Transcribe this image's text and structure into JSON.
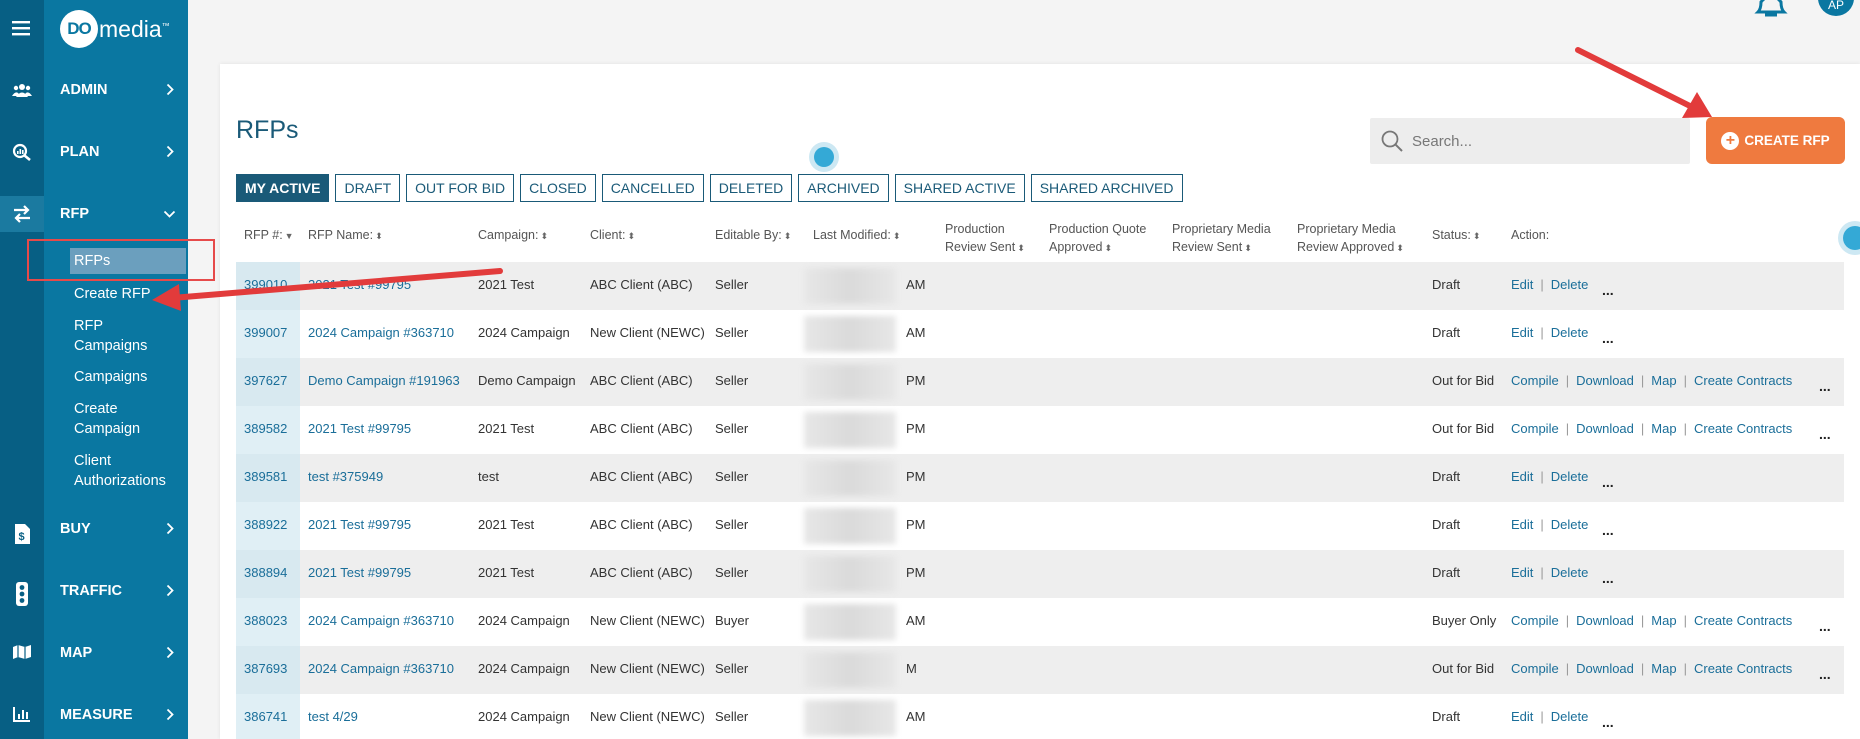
{
  "brand": {
    "logo_do": "DO",
    "logo_media": "media",
    "logo_tm": "™"
  },
  "icons": [
    "hamburger-icon",
    "users-icon",
    "plan-search-icon",
    "rfp-exchange-icon",
    "buy-dollar-icon",
    "traffic-light-icon",
    "map-icon",
    "measure-chart-icon",
    "bell-icon",
    "search-icon",
    "plus-circle-icon",
    "chevron-right-icon",
    "chevron-down-icon",
    "sort-icon"
  ],
  "colors": {
    "sidebar": "#0a77a1",
    "rail": "#075f84",
    "accent": "#ef7a3f",
    "primary": "#1a5a78",
    "highlight_red": "#e64a4a"
  },
  "user": {
    "initials": "AP"
  },
  "sidebar": {
    "admin": "ADMIN",
    "plan": "PLAN",
    "rfp": "RFP",
    "rfp_sub": {
      "rfps": "RFPs",
      "create_rfp": "Create RFP",
      "rfp_campaigns_1": "RFP",
      "rfp_campaigns_2": "Campaigns",
      "campaigns": "Campaigns",
      "create_campaign_1": "Create",
      "create_campaign_2": "Campaign",
      "client_auth_1": "Client",
      "client_auth_2": "Authorizations"
    },
    "buy": "BUY",
    "traffic": "TRAFFIC",
    "map": "MAP",
    "measure": "MEASURE"
  },
  "page": {
    "title": "RFPs",
    "search_placeholder": "Search...",
    "create_button": "CREATE RFP"
  },
  "tabs": [
    "MY ACTIVE",
    "DRAFT",
    "OUT FOR BID",
    "CLOSED",
    "CANCELLED",
    "DELETED",
    "ARCHIVED",
    "SHARED ACTIVE",
    "SHARED ARCHIVED"
  ],
  "columns": {
    "rfp_num": "RFP #:",
    "rfp_name": "RFP Name:",
    "campaign": "Campaign:",
    "client": "Client:",
    "editable_by": "Editable By:",
    "last_modified": "Last Modified:",
    "prod_review_1": "Production",
    "prod_review_2": "Review Sent",
    "prod_quote_1": "Production Quote",
    "prod_quote_2": "Approved",
    "prop_sent_1": "Proprietary Media",
    "prop_sent_2": "Review Sent",
    "prop_appr_1": "Proprietary Media",
    "prop_appr_2": "Review Approved",
    "status": "Status:",
    "action": "Action:"
  },
  "actions": {
    "edit": "Edit",
    "delete": "Delete",
    "compile": "Compile",
    "download": "Download",
    "map": "Map",
    "create_contracts": "Create Contracts",
    "more": "..."
  },
  "rows": [
    {
      "id": "399010",
      "name": "2021 Test #99795",
      "campaign": "2021 Test",
      "client": "ABC Client (ABC)",
      "editable": "Seller",
      "modified": "AM",
      "status": "Draft",
      "kind": "draft"
    },
    {
      "id": "399007",
      "name": "2024 Campaign #363710",
      "campaign": "2024 Campaign",
      "client": "New Client (NEWC)",
      "editable": "Seller",
      "modified": "AM",
      "status": "Draft",
      "kind": "draft"
    },
    {
      "id": "397627",
      "name": "Demo Campaign #191963",
      "campaign": "Demo Campaign",
      "client": "ABC Client (ABC)",
      "editable": "Seller",
      "modified": "PM",
      "status": "Out for Bid",
      "kind": "bid"
    },
    {
      "id": "389582",
      "name": "2021 Test #99795",
      "campaign": "2021 Test",
      "client": "ABC Client (ABC)",
      "editable": "Seller",
      "modified": "PM",
      "status": "Out for Bid",
      "kind": "bid"
    },
    {
      "id": "389581",
      "name": "test #375949",
      "campaign": "test",
      "client": "ABC Client (ABC)",
      "editable": "Seller",
      "modified": "PM",
      "status": "Draft",
      "kind": "draft"
    },
    {
      "id": "388922",
      "name": "2021 Test #99795",
      "campaign": "2021 Test",
      "client": "ABC Client (ABC)",
      "editable": "Seller",
      "modified": "PM",
      "status": "Draft",
      "kind": "draft"
    },
    {
      "id": "388894",
      "name": "2021 Test #99795",
      "campaign": "2021 Test",
      "client": "ABC Client (ABC)",
      "editable": "Seller",
      "modified": "PM",
      "status": "Draft",
      "kind": "draft"
    },
    {
      "id": "388023",
      "name": "2024 Campaign #363710",
      "campaign": "2024 Campaign",
      "client": "New Client (NEWC)",
      "editable": "Buyer",
      "modified": "AM",
      "status": "Buyer Only",
      "kind": "bid"
    },
    {
      "id": "387693",
      "name": "2024 Campaign #363710",
      "campaign": "2024 Campaign",
      "client": "New Client (NEWC)",
      "editable": "Seller",
      "modified": "M",
      "status": "Out for Bid",
      "kind": "bid"
    },
    {
      "id": "386741",
      "name": "test 4/29",
      "campaign": "2024 Campaign",
      "client": "New Client (NEWC)",
      "editable": "Seller",
      "modified": "AM",
      "status": "Draft",
      "kind": "draft"
    }
  ]
}
